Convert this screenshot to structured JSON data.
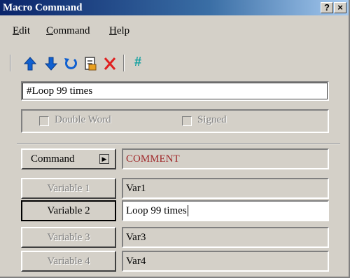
{
  "window": {
    "title": "Macro Command",
    "help_btn": "?",
    "close_btn": "×"
  },
  "menu": [
    {
      "hot": "E",
      "rest": "dit"
    },
    {
      "hot": "C",
      "rest": "ommand"
    },
    {
      "hot": "H",
      "rest": "elp"
    }
  ],
  "toolbar": {
    "icons": [
      "move-up-icon",
      "move-down-icon",
      "undo-icon",
      "document-icon",
      "delete-icon",
      "comment-icon"
    ],
    "colors": {
      "arrow": "#1060d0",
      "delete": "#e02020",
      "hash": "#10a0a0"
    },
    "hash_label": "#"
  },
  "comment_field": "#Loop 99 times",
  "options": {
    "double_word": "Double Word",
    "signed": "Signed"
  },
  "command": {
    "label": "Command",
    "value": "COMMENT"
  },
  "variables": [
    {
      "label": "Variable 1",
      "value": "Var1"
    },
    {
      "label": "Variable 2",
      "value": "Loop 99 times"
    },
    {
      "label": "Variable 3",
      "value": "Var3"
    },
    {
      "label": "Variable 4",
      "value": "Var4"
    }
  ]
}
